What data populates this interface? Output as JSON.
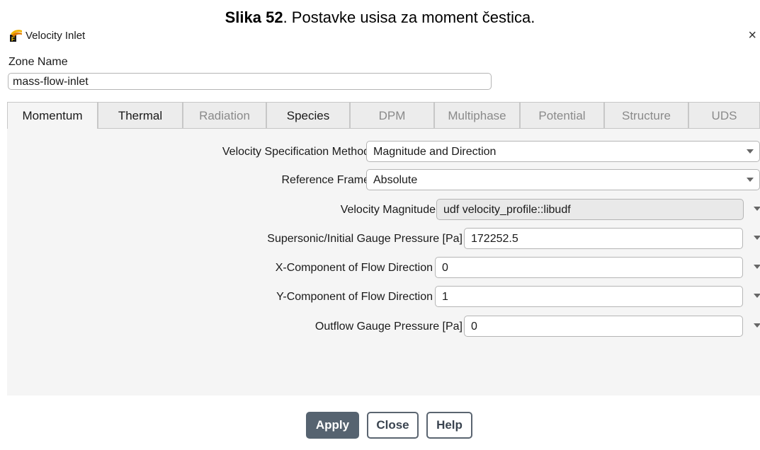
{
  "caption": {
    "number": "Slika 52",
    "text": ". Postavke usisa za moment čestica."
  },
  "window": {
    "title": "Velocity Inlet",
    "close_glyph": "×",
    "icon": "fluent-app-icon"
  },
  "zone": {
    "label": "Zone Name",
    "value": "mass-flow-inlet"
  },
  "tabs": [
    {
      "label": "Momentum",
      "state": "active"
    },
    {
      "label": "Thermal",
      "state": "enabled"
    },
    {
      "label": "Radiation",
      "state": "disabled"
    },
    {
      "label": "Species",
      "state": "enabled"
    },
    {
      "label": "DPM",
      "state": "disabled"
    },
    {
      "label": "Multiphase",
      "state": "disabled"
    },
    {
      "label": "Potential",
      "state": "disabled"
    },
    {
      "label": "Structure",
      "state": "disabled"
    },
    {
      "label": "UDS",
      "state": "disabled"
    }
  ],
  "momentum": {
    "velocity_method": {
      "label": "Velocity Specification Method",
      "value": "Magnitude and Direction"
    },
    "reference_frame": {
      "label": "Reference Frame",
      "value": "Absolute"
    },
    "velocity_magnitude": {
      "label": "Velocity Magnitude",
      "value": "udf velocity_profile::libudf"
    },
    "gauge_pressure": {
      "label": "Supersonic/Initial Gauge Pressure [Pa]",
      "value": "172252.5"
    },
    "x_component": {
      "label": "X-Component of Flow Direction",
      "value": "0"
    },
    "y_component": {
      "label": "Y-Component of Flow Direction",
      "value": "1"
    },
    "outflow_pressure": {
      "label": "Outflow Gauge Pressure [Pa]",
      "value": "0"
    }
  },
  "buttons": {
    "apply": "Apply",
    "close": "Close",
    "help": "Help"
  },
  "colors": {
    "primary_button": "#566370",
    "panel_bg": "#f5f5f5",
    "disabled_text": "#8a8a8a"
  }
}
